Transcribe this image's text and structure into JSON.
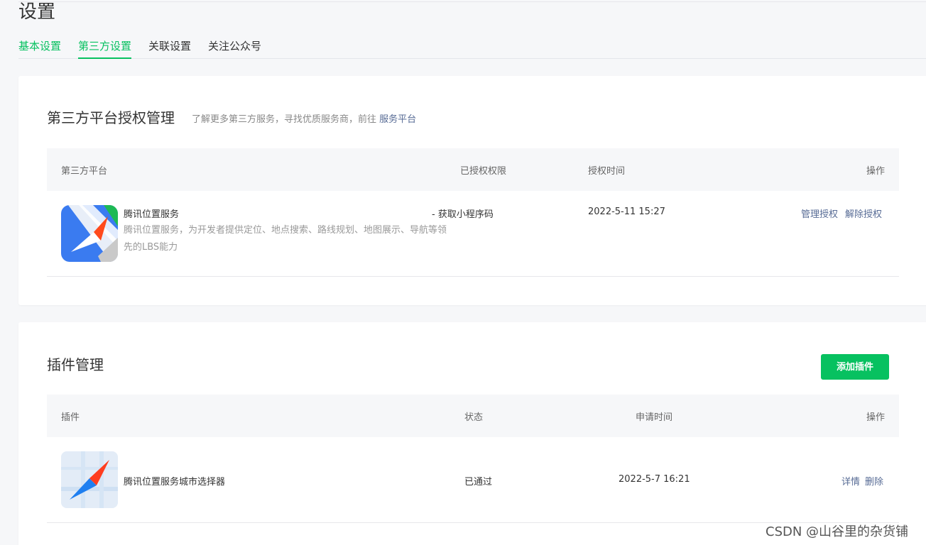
{
  "page": {
    "title": "设置"
  },
  "tabs": [
    {
      "label": "基本设置"
    },
    {
      "label": "第三方设置"
    },
    {
      "label": "关联设置"
    },
    {
      "label": "关注公众号"
    }
  ],
  "third_party": {
    "title": "第三方平台授权管理",
    "desc_prefix": "了解更多第三方服务，寻找优质服务商，前往",
    "desc_link": "服务平台",
    "columns": [
      "第三方平台",
      "已授权权限",
      "授权时间",
      "操作"
    ],
    "row": {
      "name": "腾讯位置服务",
      "desc": "腾讯位置服务，为开发者提供定位、地点搜索、路线规划、地图展示、导航等领先的LBS能力",
      "permission": "- 获取小程序码",
      "time": "2022-5-11 15:27",
      "action_manage": "管理授权",
      "action_revoke": "解除授权"
    }
  },
  "plugins": {
    "title": "插件管理",
    "add_button": "添加插件",
    "columns": [
      "插件",
      "状态",
      "申请时间",
      "操作"
    ],
    "row": {
      "name": "腾讯位置服务城市选择器",
      "status": "已通过",
      "time": "2022-5-7 16:21",
      "action_detail": "详情",
      "action_delete": "删除"
    }
  },
  "watermark": "CSDN @山谷里的杂货铺",
  "colors": {
    "accent": "#07c160",
    "link": "#576b95"
  }
}
